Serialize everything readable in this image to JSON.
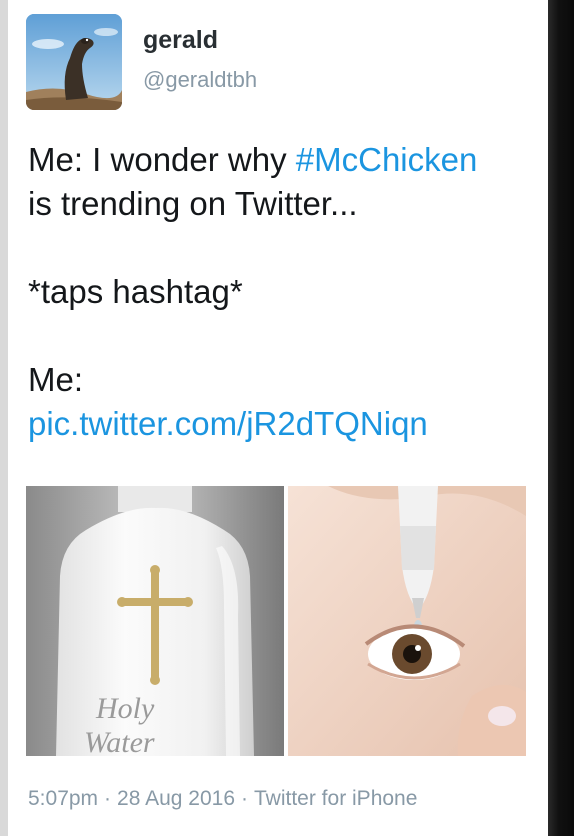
{
  "author": {
    "name": "gerald",
    "handle": "@geraldtbh"
  },
  "tweet": {
    "line1_prefix": "Me: I wonder why ",
    "hashtag": "#McChicken",
    "line2": "is trending on Twitter...",
    "line3": "*taps hashtag*",
    "line4": "Me:",
    "pic_link": "pic.twitter.com/jR2dTQNiqn"
  },
  "media": {
    "left_image_text_line1": "Holy",
    "left_image_text_line2": "Water"
  },
  "meta": {
    "time": "5:07pm",
    "separator": "·",
    "date": "28 Aug 2016",
    "source": "Twitter for iPhone"
  },
  "colors": {
    "link": "#1b95e0",
    "name": "#292f33",
    "muted": "#8899a6"
  }
}
